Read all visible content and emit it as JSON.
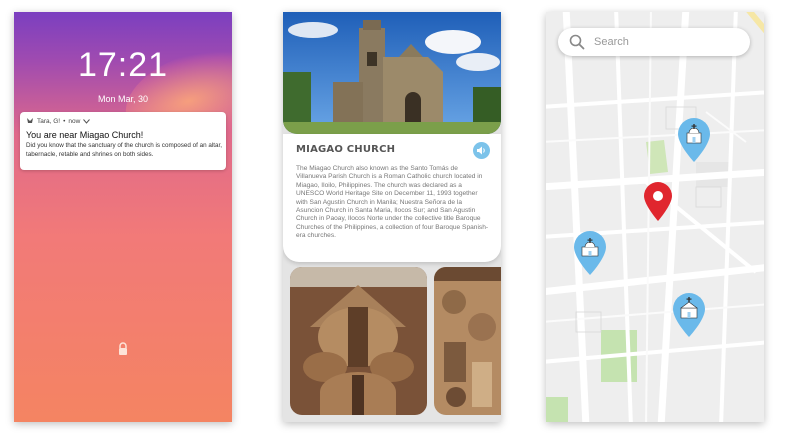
{
  "lockscreen": {
    "time": "17:21",
    "date": "Mon Mar, 30",
    "notification": {
      "app": "Tara, G!",
      "when": "now",
      "title": "You are near Miagao Church!",
      "body": "Did you know that the sanctuary of the church is composed of an altar, tabernacle, retable and shrines on both sides."
    }
  },
  "church": {
    "title": "MIAGAO CHURCH",
    "description": "The Miagao Church also known as the Santo Tomás de Villanueva Parish Church is a Roman Catholic church located in Miagao, Iloilo, Philippines. The church was declared as a UNESCO World Heritage Site on December 11, 1993 together with San Agustin Church in Manila; Nuestra Señora de la Asuncion Church in Santa Maria, Ilocos Sur; and San Agustin Church in Paoay, Ilocos Norte under the collective title Baroque Churches of the Philippines, a collection of four Baroque Spanish-era churches."
  },
  "map": {
    "search_placeholder": "Search",
    "pins": [
      {
        "name": "church-landmark-pin",
        "icon": "church-icon",
        "color": "#6ab9ea"
      },
      {
        "name": "current-location-pin",
        "icon": "location-marker-icon",
        "color": "#e0262e"
      },
      {
        "name": "church-landmark-pin",
        "icon": "church-icon",
        "color": "#6ab9ea"
      },
      {
        "name": "church-landmark-pin",
        "icon": "church-icon",
        "color": "#6ab9ea"
      }
    ]
  }
}
